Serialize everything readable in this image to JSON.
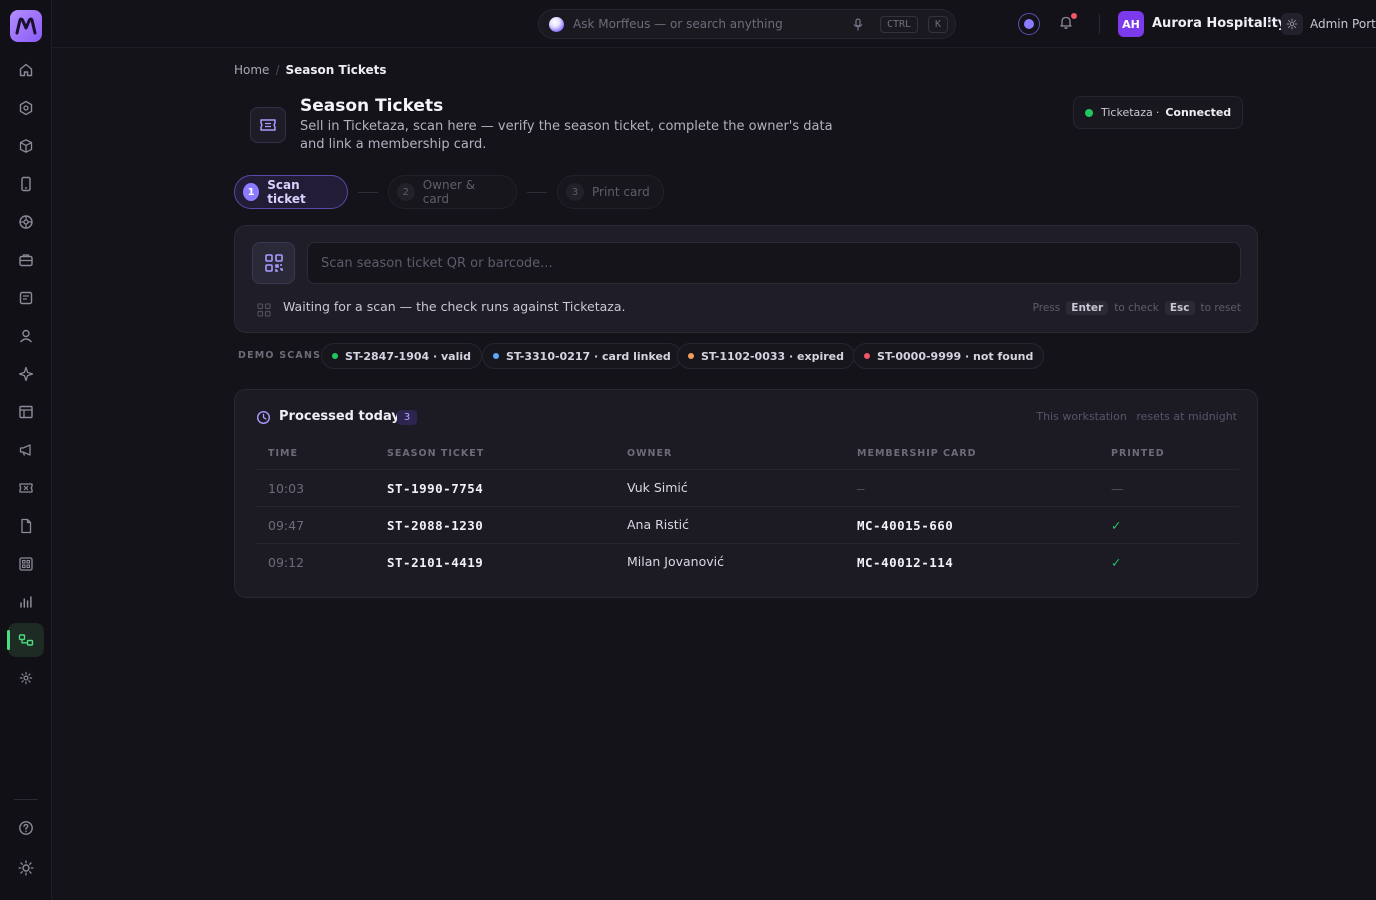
{
  "topbar": {
    "search_placeholder": "Ask Morffeus — or search anything",
    "kbd_ctrl": "CTRL",
    "kbd_k": "K",
    "avatar_initials": "AH",
    "org_name": "Aurora Hospitality",
    "portal_label": "Admin Portal"
  },
  "breadcrumb": {
    "home": "Home",
    "current": "Season Tickets"
  },
  "header": {
    "title": "Season Tickets",
    "subtitle": "Sell in Ticketaza, scan here — verify the season ticket, complete the owner's data and link a membership card.",
    "connection_name": "Ticketaza",
    "connection_sep": "·",
    "connection_status": "Connected"
  },
  "steps": [
    {
      "num": "1",
      "label": "Scan ticket"
    },
    {
      "num": "2",
      "label": "Owner & card"
    },
    {
      "num": "3",
      "label": "Print card"
    }
  ],
  "scan": {
    "placeholder": "Scan season ticket QR or barcode...",
    "waiting": "Waiting for a scan — the check runs against Ticketaza.",
    "hint_press": "Press",
    "hint_enter": "Enter",
    "hint_check": "to check",
    "hint_esc": "Esc",
    "hint_reset": "to reset"
  },
  "demo": {
    "label": "DEMO SCANS",
    "chips": [
      {
        "text": "ST-2847-1904 · valid",
        "color": "#22c55e"
      },
      {
        "text": "ST-3310-0217 · card linked",
        "color": "#60a5fa"
      },
      {
        "text": "ST-1102-0033 · expired",
        "color": "#f59e5b"
      },
      {
        "text": "ST-0000-9999 · not found",
        "color": "#f0566a"
      }
    ]
  },
  "processed": {
    "title": "Processed today",
    "count": "3",
    "meta_a": "This workstation",
    "meta_b": "resets at midnight",
    "headers": [
      "TIME",
      "SEASON TICKET",
      "OWNER",
      "MEMBERSHIP CARD",
      "PRINTED"
    ],
    "rows": [
      {
        "time": "10:03",
        "ticket": "ST-1990-7754",
        "owner": "Vuk Simić",
        "card": "—",
        "printed": "—"
      },
      {
        "time": "09:47",
        "ticket": "ST-2088-1230",
        "owner": "Ana Ristić",
        "card": "MC-40015-660",
        "printed": "✓"
      },
      {
        "time": "09:12",
        "ticket": "ST-2101-4419",
        "owner": "Milan Jovanović",
        "card": "MC-40012-114",
        "printed": "✓"
      }
    ]
  },
  "colors": {
    "accent": "#8b7bff",
    "active_nav": "#4ade80",
    "connected": "#22c55e"
  }
}
